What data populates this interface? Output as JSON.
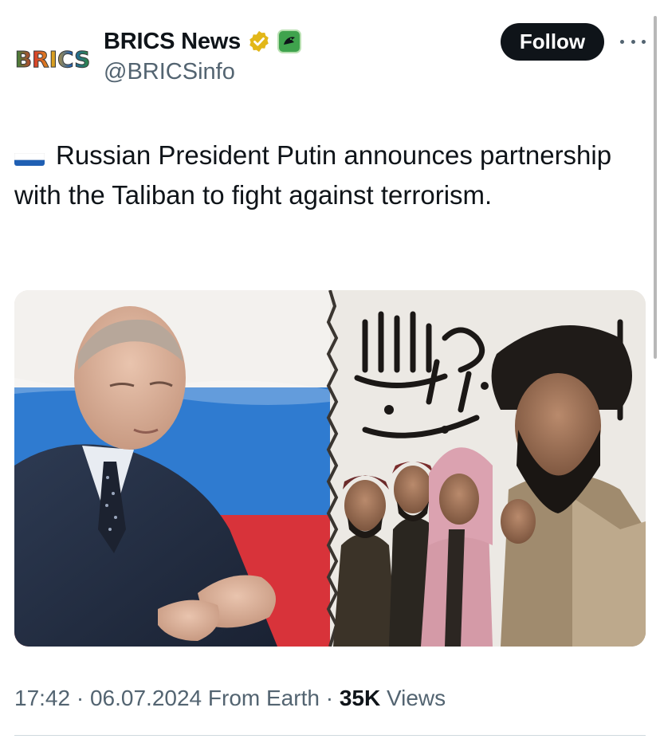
{
  "author": {
    "avatar_logo_text": "BRICS",
    "display_name": "BRICS News",
    "handle": "@BRICSinfo",
    "verified": true
  },
  "actions": {
    "follow_label": "Follow"
  },
  "tweet": {
    "flag_icon": "russia-flag-icon",
    "text": "Russian President Putin announces partnership with the Taliban to fight against terrorism."
  },
  "meta": {
    "time": "17:42",
    "separator_1": " · ",
    "date": "06.07.2024",
    "source": " From Earth",
    "separator_2": " · ",
    "views_count": "35K",
    "views_label": " Views"
  },
  "colors": {
    "text_primary": "#0f1419",
    "text_secondary": "#536471",
    "follow_bg": "#0f1419",
    "verified_gold": "#e2b719",
    "affiliate_green": "#3fa34d",
    "flag_white": "#ffffff",
    "flag_blue": "#1f5fb3",
    "flag_red": "#d52b1e"
  },
  "icons": {
    "verified": "verified-badge-icon",
    "affiliate": "affiliate-badge-icon",
    "more": "more-options-icon"
  }
}
